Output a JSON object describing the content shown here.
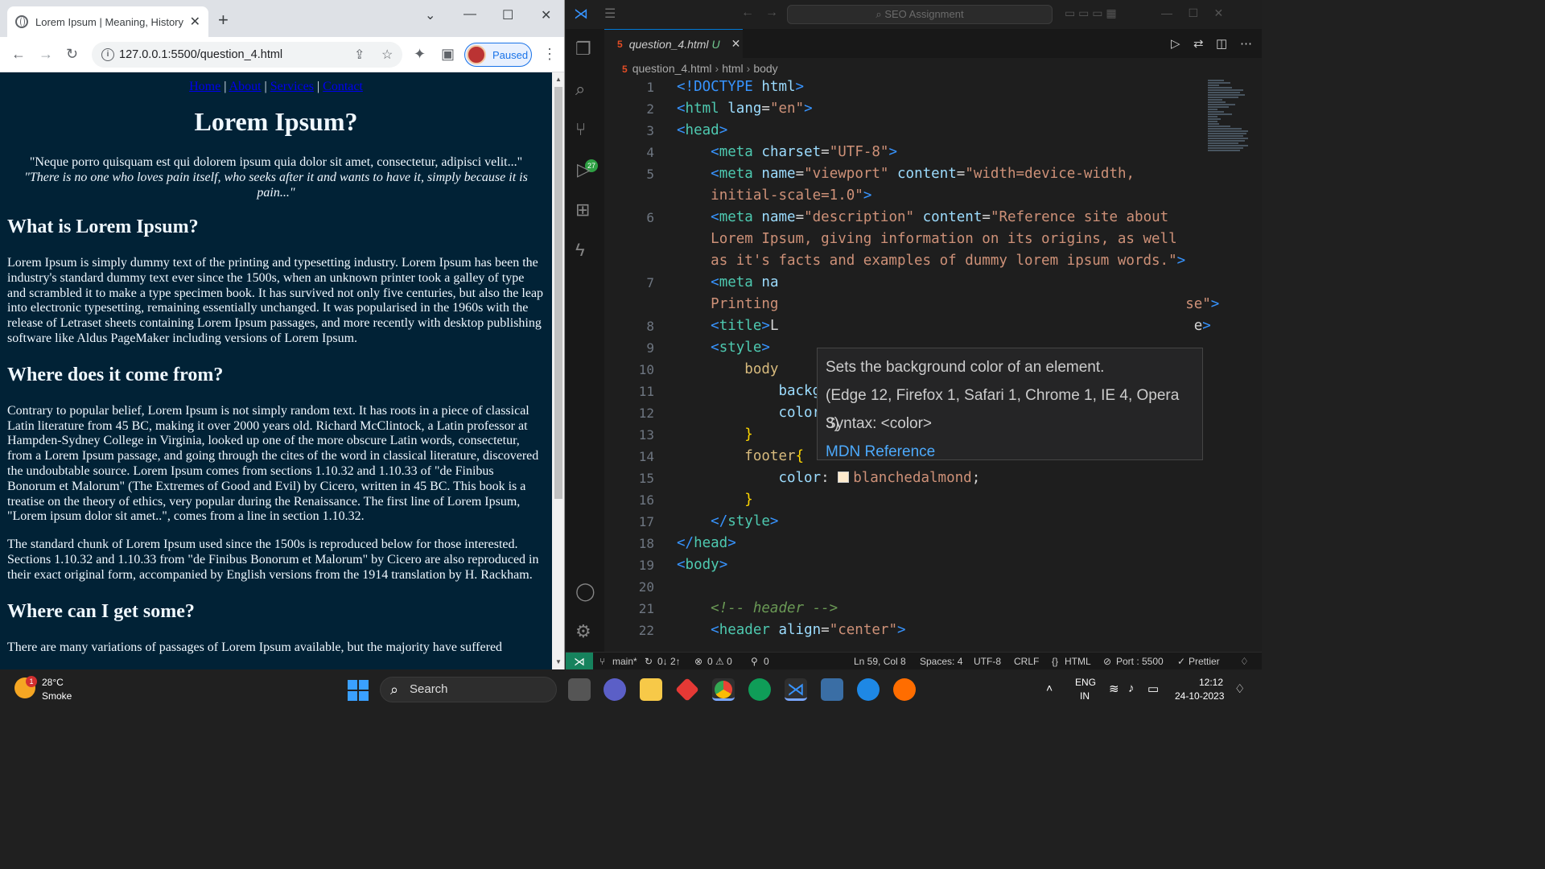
{
  "chrome": {
    "tab_title": "Lorem Ipsum | Meaning, History",
    "url": "127.0.0.1:5500/question_4.html",
    "profile_status": "Paused",
    "page": {
      "nav": [
        "Home",
        "About",
        "Services",
        "Contact"
      ],
      "title": "Lorem Ipsum?",
      "quote_line1": "\"Neque porro quisquam est qui dolorem ipsum quia dolor sit amet, consectetur, adipisci velit...\"",
      "quote_line2": "\"There is no one who loves pain itself, who seeks after it and wants to have it, simply because it is pain...\"",
      "h2_what": "What is Lorem Ipsum?",
      "p_what": "Lorem Ipsum is simply dummy text of the printing and typesetting industry. Lorem Ipsum has been the industry's standard dummy text ever since the 1500s, when an unknown printer took a galley of type and scrambled it to make a type specimen book. It has survived not only five centuries, but also the leap into electronic typesetting, remaining essentially unchanged. It was popularised in the 1960s with the release of Letraset sheets containing Lorem Ipsum passages, and more recently with desktop publishing software like Aldus PageMaker including versions of Lorem Ipsum.",
      "h2_where": "Where does it come from?",
      "p_where1": "Contrary to popular belief, Lorem Ipsum is not simply random text. It has roots in a piece of classical Latin literature from 45 BC, making it over 2000 years old. Richard McClintock, a Latin professor at Hampden-Sydney College in Virginia, looked up one of the more obscure Latin words, consectetur, from a Lorem Ipsum passage, and going through the cites of the word in classical literature, discovered the undoubtable source. Lorem Ipsum comes from sections 1.10.32 and 1.10.33 of \"de Finibus Bonorum et Malorum\" (The Extremes of Good and Evil) by Cicero, written in 45 BC. This book is a treatise on the theory of ethics, very popular during the Renaissance. The first line of Lorem Ipsum, \"Lorem ipsum dolor sit amet..\", comes from a line in section 1.10.32.",
      "p_where2": "The standard chunk of Lorem Ipsum used since the 1500s is reproduced below for those interested. Sections 1.10.32 and 1.10.33 from \"de Finibus Bonorum et Malorum\" by Cicero are also reproduced in their exact original form, accompanied by English versions from the 1914 translation by H. Rackham.",
      "h2_get": "Where can I get some?",
      "p_get": "There are many variations of passages of Lorem Ipsum available, but the majority have suffered"
    }
  },
  "vscode": {
    "command_center": "SEO Assignment",
    "scm_badge": "27",
    "tab_name": "question_4.html",
    "tab_modified": "U",
    "breadcrumb": [
      "question_4.html",
      "html",
      "body"
    ],
    "line_numbers": [
      "1",
      "2",
      "3",
      "4",
      "5",
      "",
      "6",
      "",
      "",
      "7",
      "",
      "8",
      "9",
      "10",
      "11",
      "12",
      "13",
      "14",
      "15",
      "16",
      "17",
      "18",
      "19",
      "20",
      "21",
      "22"
    ],
    "hover": {
      "description": "Sets the background color of an element.",
      "compat": "(Edge 12, Firefox 1, Safari 1, Chrome 1, IE 4, Opera 3)",
      "syntax": "Syntax: <color>",
      "link": "MDN Reference"
    },
    "colors": {
      "body_bg": "#012236",
      "aliceblue": "#f0f8ff",
      "blanchedalmond": "#ffebcd"
    },
    "status": {
      "branch": "main*",
      "sync": "0↓ 2↑",
      "problems": "0 ⚠ 0",
      "ports": "0",
      "position": "Ln 59, Col 8",
      "spaces": "Spaces: 4",
      "encoding": "UTF-8",
      "eol": "CRLF",
      "language": "HTML",
      "port": "Port : 5500",
      "formatter": "Prettier"
    }
  },
  "taskbar": {
    "weather_temp": "28°C",
    "weather_desc": "Smoke",
    "weather_badge": "1",
    "search": "Search",
    "lang1": "ENG",
    "lang2": "IN",
    "time": "12:12",
    "date": "24-10-2023"
  }
}
